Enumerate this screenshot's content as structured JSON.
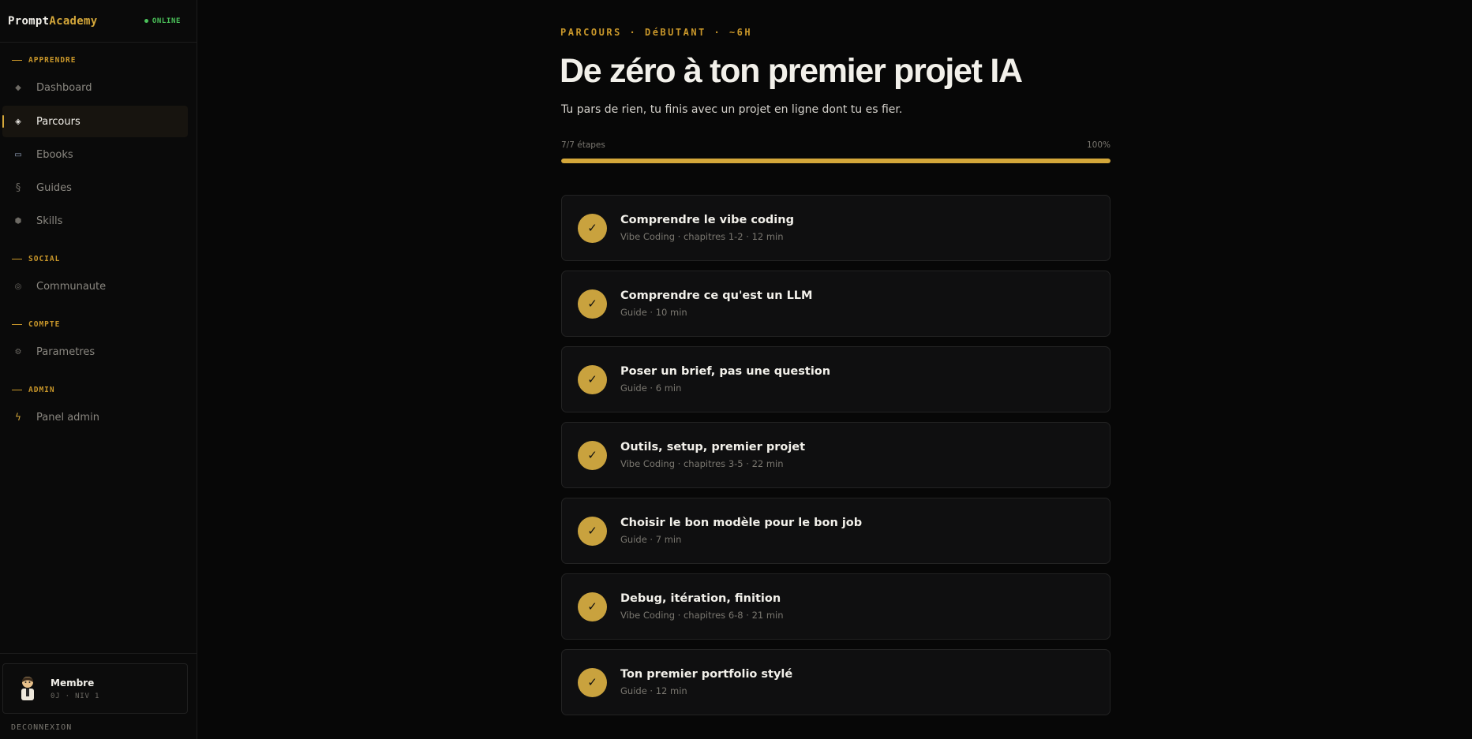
{
  "brand": {
    "part1": "Prompt",
    "part2": "Academy",
    "status": "ONLINE"
  },
  "colors": {
    "accent": "#d4a73a",
    "online": "#4bc25a",
    "background": "#070707"
  },
  "sidebar": {
    "sections": [
      {
        "title": "APPRENDRE",
        "items": [
          {
            "label": "Dashboard",
            "icon": "diamond-icon"
          },
          {
            "label": "Parcours",
            "icon": "target-icon",
            "active": true
          },
          {
            "label": "Ebooks",
            "icon": "book-icon"
          },
          {
            "label": "Guides",
            "icon": "section-icon"
          },
          {
            "label": "Skills",
            "icon": "hexagon-icon"
          }
        ]
      },
      {
        "title": "SOCIAL",
        "items": [
          {
            "label": "Communaute",
            "icon": "community-icon"
          }
        ]
      },
      {
        "title": "COMPTE",
        "items": [
          {
            "label": "Parametres",
            "icon": "gear-icon"
          }
        ]
      },
      {
        "title": "ADMIN",
        "items": [
          {
            "label": "Panel admin",
            "icon": "bolt-icon"
          }
        ]
      }
    ],
    "user": {
      "name": "Membre",
      "meta": "0J · NIV 1"
    },
    "logout": "DECONNEXION"
  },
  "main": {
    "eyebrow": "PARCOURS · DéBUTANT · ~6H",
    "title": "De zéro à ton premier projet IA",
    "subtitle": "Tu pars de rien, tu finis avec un projet en ligne dont tu es fier.",
    "progress": {
      "label": "7/7 étapes",
      "percent_label": "100%",
      "value": 1.0
    },
    "steps": [
      {
        "title": "Comprendre le vibe coding",
        "meta": "Vibe Coding · chapitres 1-2 · 12 min",
        "done": true
      },
      {
        "title": "Comprendre ce qu'est un LLM",
        "meta": "Guide · 10 min",
        "done": true
      },
      {
        "title": "Poser un brief, pas une question",
        "meta": "Guide · 6 min",
        "done": true
      },
      {
        "title": "Outils, setup, premier projet",
        "meta": "Vibe Coding · chapitres 3-5 · 22 min",
        "done": true
      },
      {
        "title": "Choisir le bon modèle pour le bon job",
        "meta": "Guide · 7 min",
        "done": true
      },
      {
        "title": "Debug, itération, finition",
        "meta": "Vibe Coding · chapitres 6-8 · 21 min",
        "done": true
      },
      {
        "title": "Ton premier portfolio stylé",
        "meta": "Guide · 12 min",
        "done": true
      }
    ]
  }
}
